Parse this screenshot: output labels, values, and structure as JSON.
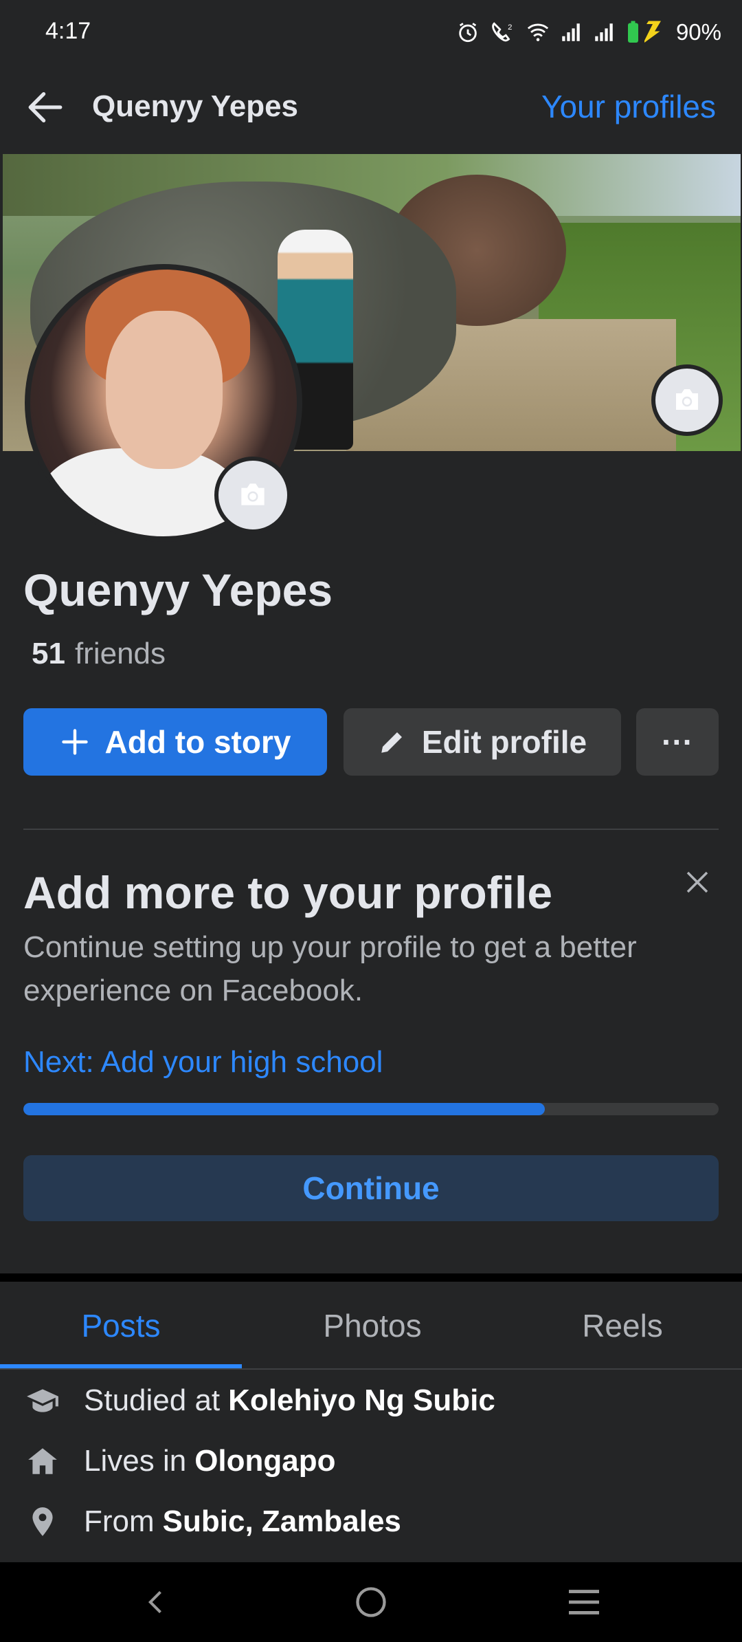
{
  "status": {
    "time": "4:17",
    "battery_percent": "90%",
    "icons": [
      "alarm-icon",
      "wifi-calling-icon",
      "wifi-icon",
      "signal-icon",
      "signal-icon",
      "battery-charging-icon"
    ]
  },
  "header": {
    "title": "Quenyy Yepes",
    "your_profiles": "Your profiles"
  },
  "profile": {
    "name": "Quenyy Yepes",
    "friends_count": "51",
    "friends_label": "friends"
  },
  "actions": {
    "add_to_story": "Add to story",
    "edit_profile": "Edit profile",
    "more": "···"
  },
  "card": {
    "title": "Add more to your profile",
    "description": "Continue setting up your profile to get a better experience on Facebook.",
    "next": "Next: Add your high school",
    "progress_fraction": 0.75,
    "continue": "Continue"
  },
  "tabs": [
    {
      "label": "Posts",
      "active": true
    },
    {
      "label": "Photos",
      "active": false
    },
    {
      "label": "Reels",
      "active": false
    }
  ],
  "details": {
    "education": {
      "prefix": "Studied at",
      "value": "Kolehiyo Ng Subic"
    },
    "home": {
      "prefix": "Lives in",
      "value": "Olongapo"
    },
    "from": {
      "prefix": "From",
      "value": "Subic, Zambales"
    }
  },
  "colors": {
    "background": "#242526",
    "accent": "#2d88ff",
    "primary_button": "#2374e1",
    "secondary_button": "#3a3b3c"
  }
}
